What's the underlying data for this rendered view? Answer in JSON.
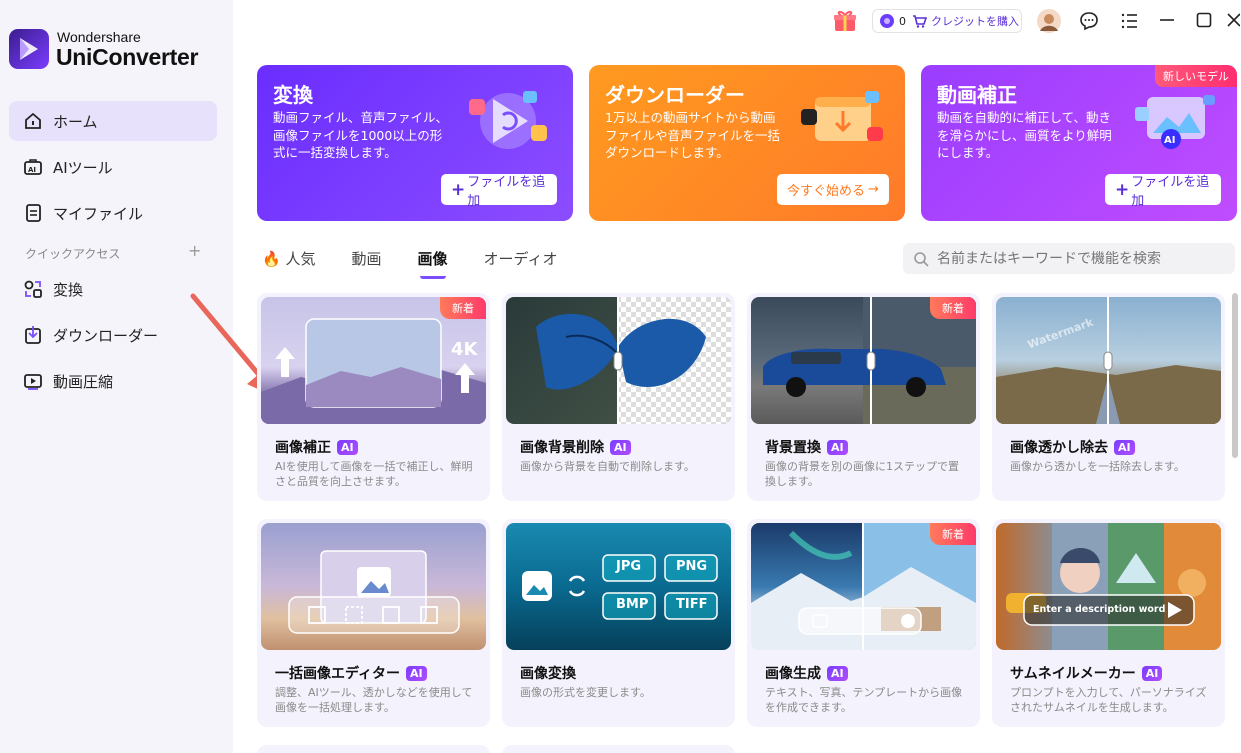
{
  "app": {
    "brand_small": "Wondershare",
    "brand_big": "UniConverter"
  },
  "sidebar": {
    "items": [
      {
        "label": "ホーム",
        "icon": "home-icon"
      },
      {
        "label": "AIツール",
        "icon": "ai-tools-icon"
      },
      {
        "label": "マイファイル",
        "icon": "my-files-icon"
      }
    ],
    "quick_access_label": "クイックアクセス",
    "quick_items": [
      {
        "label": "変換",
        "icon": "convert-icon"
      },
      {
        "label": "ダウンローダー",
        "icon": "downloader-icon"
      },
      {
        "label": "動画圧縮",
        "icon": "compress-icon"
      }
    ]
  },
  "topbar": {
    "credits": "0",
    "buy_credits": "クレジットを購入"
  },
  "promos": [
    {
      "title": "変換",
      "desc": "動画ファイル、音声ファイル、画像ファイルを1000以上の形式に一括変換します。",
      "button": "ファイルを追加",
      "color": "#7b3dff"
    },
    {
      "title": "ダウンローダー",
      "desc": "1万以上の動画サイトから動画ファイルや音声ファイルを一括ダウンロードします。",
      "button": "今すぐ始める",
      "color": "#ff8a1f"
    },
    {
      "title": "動画補正",
      "desc": "動画を自動的に補正して、動きを滑らかにし、画質をより鮮明にします。",
      "button": "ファイルを追加",
      "badge": "新しいモデル",
      "color": "#a63dff"
    }
  ],
  "tabs": [
    {
      "label": "人気"
    },
    {
      "label": "動画"
    },
    {
      "label": "画像"
    },
    {
      "label": "オーディオ"
    }
  ],
  "search": {
    "placeholder": "名前またはキーワードで機能を検索"
  },
  "cards": [
    {
      "title": "画像補正",
      "ai": "AI",
      "desc": "AIを使用して画像を一括で補正し、鮮明さと品質を向上させます。",
      "badge": "新着"
    },
    {
      "title": "画像背景削除",
      "ai": "AI",
      "desc": "画像から背景を自動で削除します。"
    },
    {
      "title": "背景置換",
      "ai": "AI",
      "desc": "画像の背景を別の画像に1ステップで置換します。",
      "badge": "新着"
    },
    {
      "title": "画像透かし除去",
      "ai": "AI",
      "desc": "画像から透かしを一括除去します。"
    },
    {
      "title": "一括画像エディター",
      "ai": "AI",
      "desc": "調整、AIツール、透かしなどを使用して画像を一括処理します。"
    },
    {
      "title": "画像変換",
      "desc": "画像の形式を変更します。"
    },
    {
      "title": "画像生成",
      "ai": "AI",
      "desc": "テキスト、写真、テンプレートから画像を作成できます。",
      "badge": "新着"
    },
    {
      "title": "サムネイルメーカー",
      "ai": "AI",
      "desc": "プロンプトを入力して、パーソナライズされたサムネイルを生成します。"
    }
  ],
  "thumbs": {
    "enhance_4k": "4K",
    "watermark": "Watermark",
    "formats": [
      "JPG",
      "PNG",
      "BMP",
      "TIFF"
    ],
    "thumbnail_prompt": "Enter a description word"
  }
}
